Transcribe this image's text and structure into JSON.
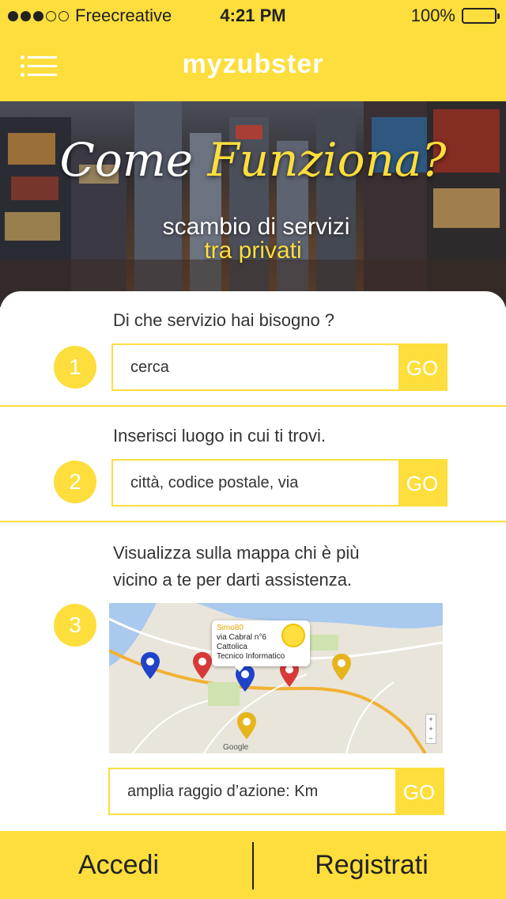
{
  "status_bar": {
    "carrier": "Freecreative",
    "time": "4:21 PM",
    "battery": "100%"
  },
  "nav": {
    "title": "myzubster",
    "menu_icon": "hamburger-menu-icon"
  },
  "hero": {
    "title_part1": "Come",
    "title_part2": "Funziona?",
    "subtitle_line1": "scambio di servizi",
    "subtitle_line2": "tra privati"
  },
  "steps": [
    {
      "number": "1",
      "text": "Di che servizio hai bisogno ?",
      "placeholder": "cerca",
      "go_label": "GO"
    },
    {
      "number": "2",
      "text": "Inserisci luogo in cui ti trovi.",
      "placeholder": "città, codice postale, via",
      "go_label": "GO"
    },
    {
      "number": "3",
      "text_line1": "Visualizza sulla mappa chi è più",
      "text_line2": "vicino a te per darti assistenza.",
      "map_callout": {
        "name": "Simo80",
        "line1": "via Cabral n°6",
        "line2": "Cattolica",
        "line3": "Tecnico Informatico"
      },
      "map_logo": "Google",
      "radius_placeholder": "amplia raggio d’azione: Km",
      "go_label": "GO"
    }
  ],
  "bottom_bar": {
    "login_label": "Accedi",
    "register_label": "Registrati"
  },
  "colors": {
    "accent": "#fdde3c",
    "text": "#333333",
    "white": "#ffffff"
  }
}
